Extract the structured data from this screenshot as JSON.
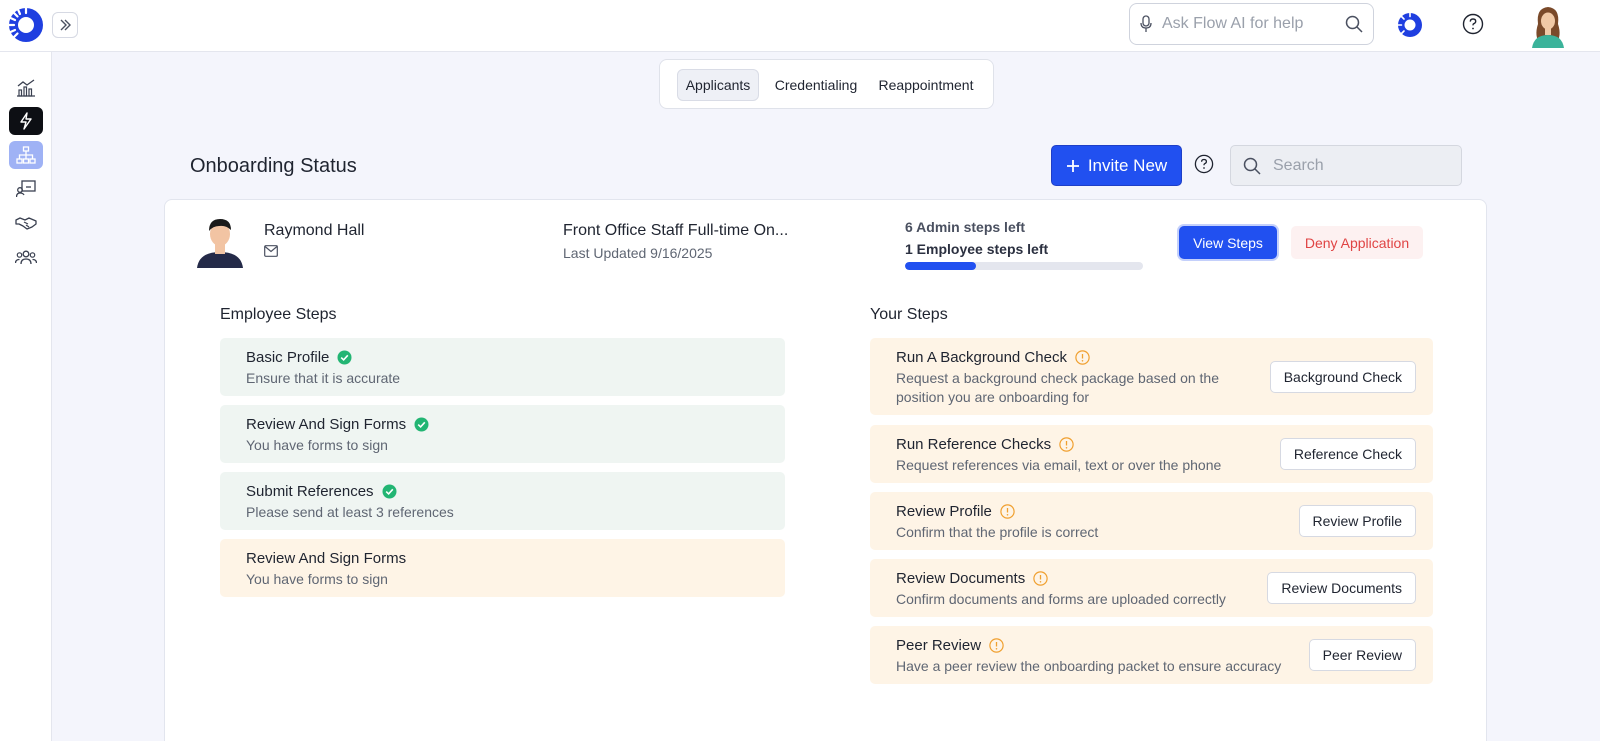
{
  "topbar": {
    "ai_search_placeholder": "Ask Flow AI for help"
  },
  "tabs": [
    {
      "label": "Applicants",
      "selected": true
    },
    {
      "label": "Credentialing",
      "selected": false
    },
    {
      "label": "Reappointment",
      "selected": false
    }
  ],
  "header": {
    "title": "Onboarding Status",
    "invite_label": "Invite New",
    "search_placeholder": "Search"
  },
  "applicant": {
    "name": "Raymond Hall",
    "position": "Front Office Staff Full-time On...",
    "last_updated": "Last Updated 9/16/2025",
    "admin_steps_left": "6 Admin steps left",
    "employee_steps_left": "1 Employee steps left",
    "progress_fraction": 0.3,
    "view_steps_label": "View Steps",
    "deny_label": "Deny Application"
  },
  "employee_steps": {
    "title": "Employee Steps",
    "items": [
      {
        "title": "Basic Profile",
        "desc": "Ensure that it is accurate",
        "status": "done"
      },
      {
        "title": "Review And Sign Forms",
        "desc": "You have forms to sign",
        "status": "done"
      },
      {
        "title": "Submit References",
        "desc": "Please send at least 3 references",
        "status": "done"
      },
      {
        "title": "Review And Sign Forms",
        "desc": "You have forms to sign",
        "status": "pending"
      }
    ]
  },
  "your_steps": {
    "title": "Your Steps",
    "items": [
      {
        "title": "Run A Background Check",
        "desc_line1": "Request a background check package based on the",
        "desc_line2": "position you are onboarding for",
        "button": "Background Check"
      },
      {
        "title": "Run Reference Checks",
        "desc_line1": "Request references via email, text or over the phone",
        "desc_line2": "",
        "button": "Reference Check"
      },
      {
        "title": "Review Profile",
        "desc_line1": "Confirm that the profile is correct",
        "desc_line2": "",
        "button": "Review Profile"
      },
      {
        "title": "Review Documents",
        "desc_line1": "Confirm documents and forms are uploaded correctly",
        "desc_line2": "",
        "button": "Review Documents"
      },
      {
        "title": "Peer Review",
        "desc_line1": "Have a peer review the onboarding packet to ensure accuracy",
        "desc_line2": "",
        "button": "Peer Review"
      }
    ]
  },
  "colors": {
    "primary": "#2150f0",
    "done_bg": "#eff5f2",
    "pending_bg": "#fef4e6",
    "check": "#22b573",
    "warn": "#f0a030",
    "deny": "#e04444"
  }
}
